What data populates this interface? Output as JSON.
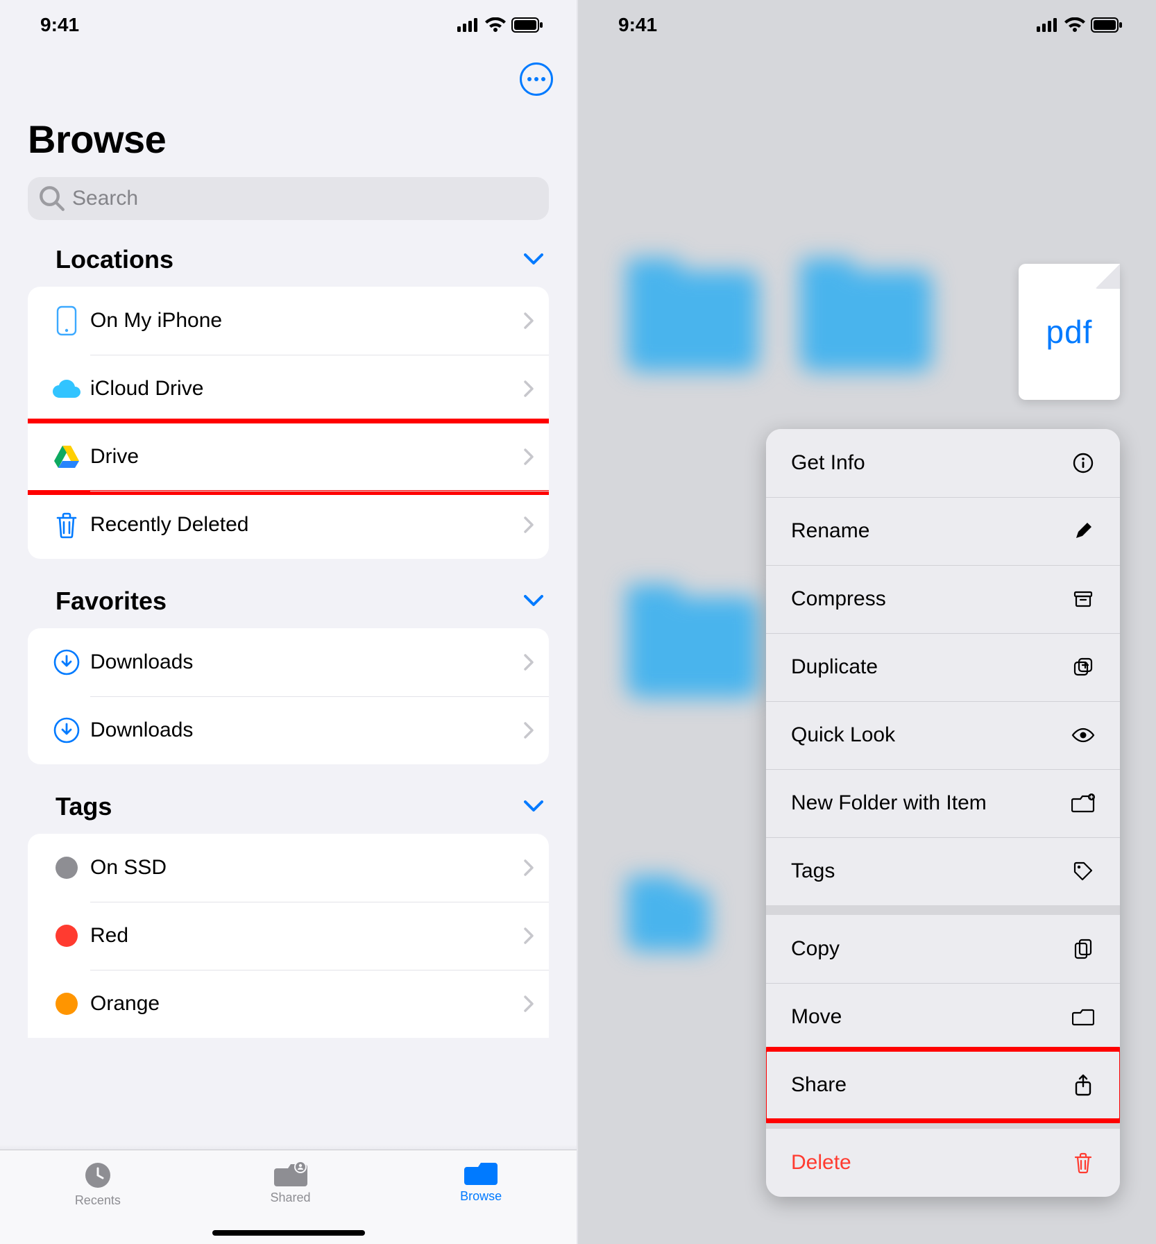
{
  "status": {
    "time": "9:41"
  },
  "left": {
    "title": "Browse",
    "search_placeholder": "Search",
    "sections": {
      "locations": {
        "header": "Locations",
        "items": [
          {
            "id": "on-my-iphone",
            "label": "On My iPhone"
          },
          {
            "id": "icloud-drive",
            "label": "iCloud Drive"
          },
          {
            "id": "google-drive",
            "label": "Drive",
            "highlighted": true
          },
          {
            "id": "recently-deleted",
            "label": "Recently Deleted"
          }
        ]
      },
      "favorites": {
        "header": "Favorites",
        "items": [
          {
            "id": "downloads-1",
            "label": "Downloads"
          },
          {
            "id": "downloads-2",
            "label": "Downloads"
          }
        ]
      },
      "tags": {
        "header": "Tags",
        "items": [
          {
            "id": "tag-onssd",
            "label": "On SSD",
            "color": "#8e8e93"
          },
          {
            "id": "tag-red",
            "label": "Red",
            "color": "#ff3b30"
          },
          {
            "id": "tag-orange",
            "label": "Orange",
            "color": "#ff9500"
          }
        ]
      }
    },
    "tabs": {
      "recents": "Recents",
      "shared": "Shared",
      "browse": "Browse",
      "active": "browse"
    }
  },
  "right": {
    "file_label": "pdf",
    "menu": {
      "groups": [
        [
          {
            "id": "get-info",
            "label": "Get Info"
          },
          {
            "id": "rename",
            "label": "Rename"
          },
          {
            "id": "compress",
            "label": "Compress"
          },
          {
            "id": "duplicate",
            "label": "Duplicate"
          },
          {
            "id": "quick-look",
            "label": "Quick Look"
          },
          {
            "id": "new-folder",
            "label": "New Folder with Item"
          },
          {
            "id": "tags",
            "label": "Tags"
          }
        ],
        [
          {
            "id": "copy",
            "label": "Copy"
          },
          {
            "id": "move",
            "label": "Move"
          },
          {
            "id": "share",
            "label": "Share",
            "highlighted": true
          }
        ],
        [
          {
            "id": "delete",
            "label": "Delete",
            "destructive": true
          }
        ]
      ]
    }
  }
}
